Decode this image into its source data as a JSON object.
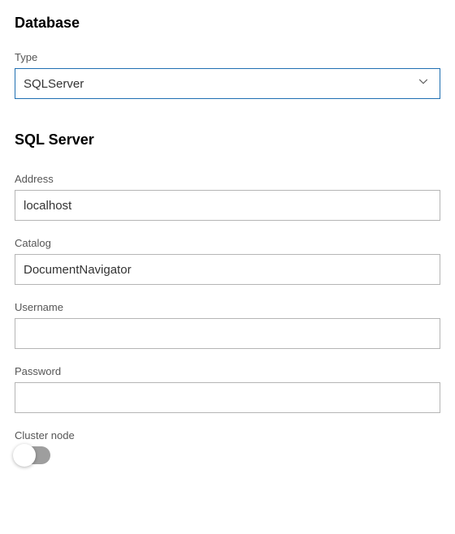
{
  "database": {
    "heading": "Database",
    "type_label": "Type",
    "type_value": "SQLServer"
  },
  "sqlserver": {
    "heading": "SQL Server",
    "address_label": "Address",
    "address_value": "localhost",
    "catalog_label": "Catalog",
    "catalog_value": "DocumentNavigator",
    "username_label": "Username",
    "username_value": "",
    "password_label": "Password",
    "password_value": "",
    "cluster_label": "Cluster node",
    "cluster_on": false
  },
  "colors": {
    "select_border": "#1f6fb2",
    "input_border": "#b5b5b5",
    "toggle_off": "#9e9e9e"
  }
}
